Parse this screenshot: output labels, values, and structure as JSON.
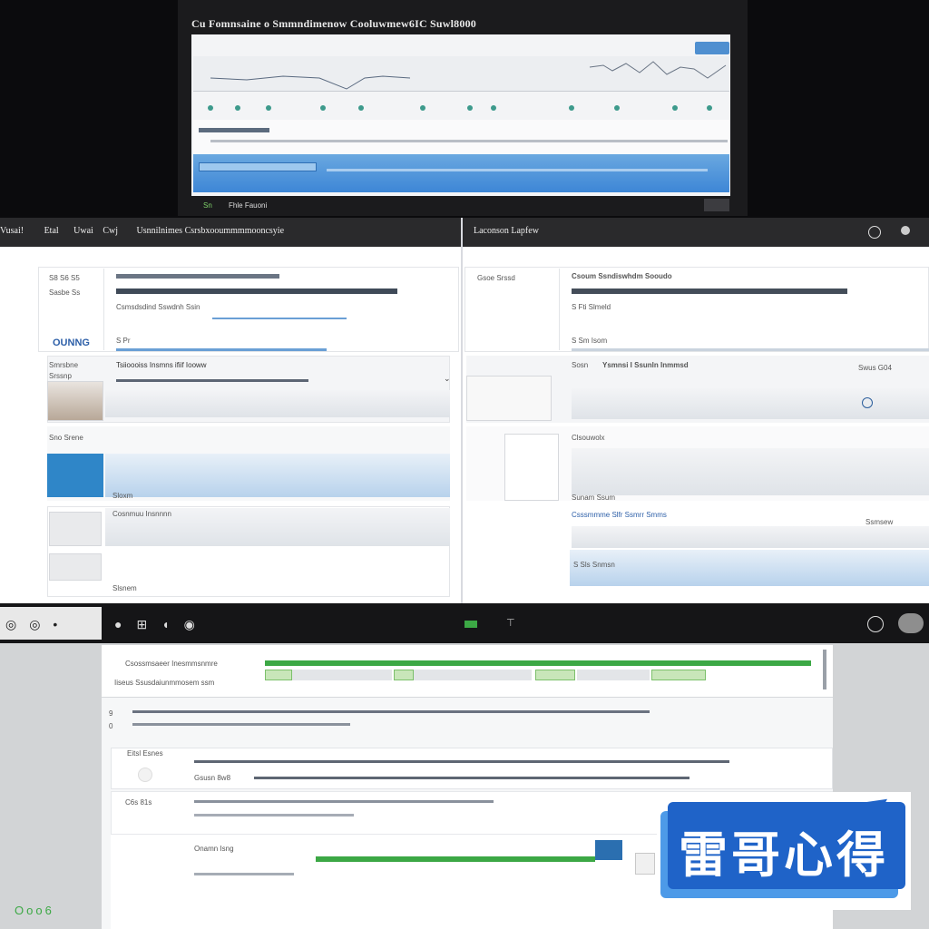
{
  "top_window": {
    "title": "Cu Fomnsaine o Smmndimenow Cooluwmew6IC Suwl8000",
    "status_left": "Sn",
    "status_right": "Fhle Fauoni"
  },
  "mid_window": {
    "tabs": [
      "Vusai!",
      "Etal",
      "Uwai",
      "Cwj"
    ],
    "title": "Usnnilnimes Csrsbxooummmmooncsyie",
    "right_title": "Laconson Lapfew",
    "left_rows": [
      {
        "label1": "S8 S6 S5",
        "label2": "Sasbe Ss",
        "badge": "OUNNG",
        "text": "Csmsdsdind Sswdnh Ssin",
        "tag": "S Pr"
      },
      {
        "label1": "Smrsbne",
        "label2": "Srssnp",
        "text": "Tsiioooiss Insmns ifiif Iooww"
      },
      {
        "label1": "Sno Srene",
        "text": "Sloxm"
      },
      {
        "label1": "Cosnmuu Insnnnn",
        "text": "Slsnem"
      }
    ],
    "right_rows": [
      {
        "label1": "Gsoe Srssd",
        "text": "Csoum Ssndiswhdm Sooudo",
        "value": "S Fti Slmeld",
        "tag": "S Sm Isom"
      },
      {
        "label1": "Sosn",
        "text": "Ysmnsi I Ssunln Inmmsd",
        "value": "Swus G04"
      },
      {
        "label1": "Clsouwolx",
        "text": "Sunam Ssum"
      },
      {
        "label1": "Csssmmme Slfr Ssmrr Smms",
        "value": "Ssmsew",
        "tag": "S Sls Snmsn"
      }
    ]
  },
  "bottom_window": {
    "header_left": "Csossmsaeer Inesmmsnmre",
    "header_left2": "Iiseus Ssusdaiunmmosem ssm",
    "row_numbers": [
      "9",
      "0"
    ],
    "section1_label": "Eitsl Esnes",
    "section1_sub": "Gsusn 8w8",
    "section2_label": "C6s 81s",
    "section3_label": "Onamn Isng",
    "bottom_indicator": "Ooo6"
  },
  "watermark": {
    "text": "雷哥心得"
  },
  "colors": {
    "accent_blue": "#3d86d6",
    "accent_green": "#3ca845",
    "dark_bar": "#151517",
    "watermark_blue": "#1f63c8"
  }
}
